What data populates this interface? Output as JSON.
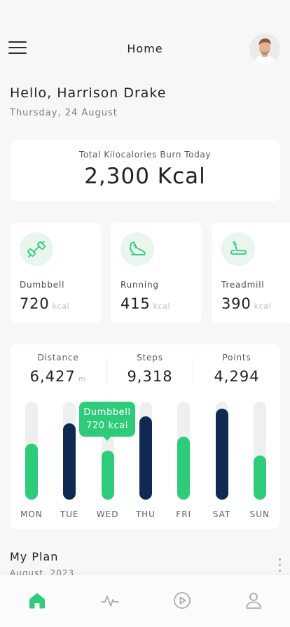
{
  "header": {
    "title": "Home"
  },
  "greeting": {
    "hello": "Hello, Harrison Drake",
    "date": "Thursday, 24 August"
  },
  "total": {
    "label": "Total Kilocalories Burn Today",
    "value": "2,300 Kcal"
  },
  "activities": [
    {
      "name": "Dumbbell",
      "value": "720",
      "unit": "kcal",
      "icon": "dumbbell-icon"
    },
    {
      "name": "Running",
      "value": "415",
      "unit": "kcal",
      "icon": "running-shoe-icon"
    },
    {
      "name": "Treadmill",
      "value": "390",
      "unit": "kcal",
      "icon": "treadmill-icon"
    }
  ],
  "stats": [
    {
      "label": "Distance",
      "value": "6,427",
      "unit": "m"
    },
    {
      "label": "Steps",
      "value": "9,318",
      "unit": ""
    },
    {
      "label": "Points",
      "value": "4,294",
      "unit": ""
    }
  ],
  "weekly": {
    "days": [
      "MON",
      "TUE",
      "WED",
      "THU",
      "FRI",
      "SAT",
      "SUN"
    ],
    "fill": [
      0.57,
      0.78,
      0.5,
      0.85,
      0.64,
      0.93,
      0.45
    ],
    "highlighted": [
      false,
      true,
      false,
      true,
      false,
      true,
      false
    ],
    "tooltip": {
      "title": "Dumbbell",
      "value": "720 kcal"
    }
  },
  "colors": {
    "accent": "#2ecc7a",
    "dark_bar": "#0f2a52",
    "track": "#eef0f0"
  },
  "plan": {
    "title": "My Plan",
    "date": "August, 2023"
  },
  "nav": [
    "home-icon",
    "activity-icon",
    "play-icon",
    "profile-icon"
  ]
}
